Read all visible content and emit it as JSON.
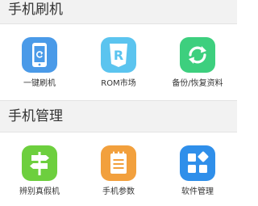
{
  "sections": [
    {
      "title": "手机刷机",
      "items": [
        {
          "label": "一键刷机",
          "icon": "phone-refresh-icon",
          "color": "#4a9ae8"
        },
        {
          "label": "ROM市场",
          "icon": "rom-shield-icon",
          "color": "#5bc4ef"
        },
        {
          "label": "备份/恢复资料",
          "icon": "sync-arrows-icon",
          "color": "#3dcf7e"
        }
      ]
    },
    {
      "title": "手机管理",
      "items": [
        {
          "label": "辨别真假机",
          "icon": "signpost-icon",
          "color": "#6dcf3e"
        },
        {
          "label": "手机参数",
          "icon": "notepad-icon",
          "color": "#f2a03d"
        },
        {
          "label": "软件管理",
          "icon": "app-grid-icon",
          "color": "#2f8fea"
        }
      ]
    }
  ]
}
